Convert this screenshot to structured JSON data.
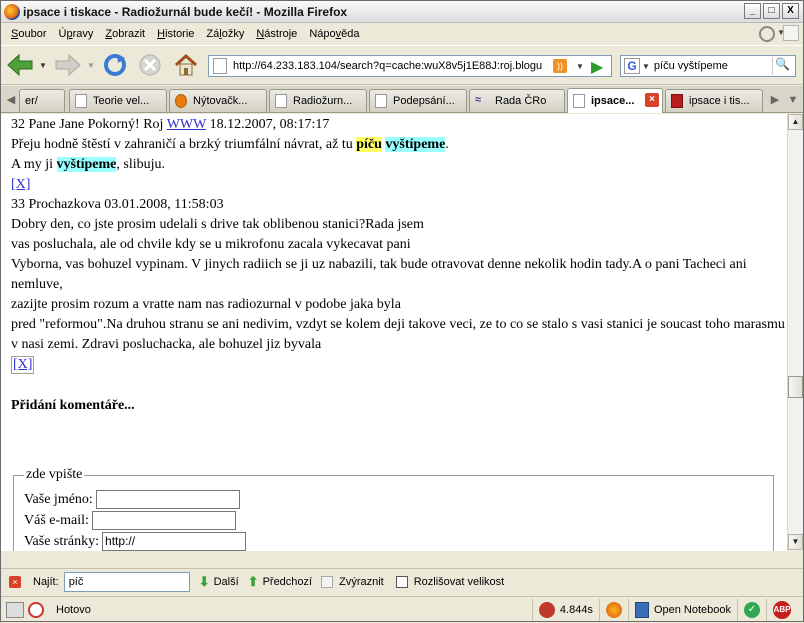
{
  "window": {
    "title": "ipsace i tiskace - Radiožurnál bude kečí! - Mozilla Firefox",
    "buttons": {
      "minimize": "_",
      "maximize": "□",
      "close": "X"
    }
  },
  "menu": [
    "Soubor",
    "Úpravy",
    "Zobrazit",
    "Historie",
    "Záložky",
    "Nástroje",
    "Nápověda"
  ],
  "menu_access_keys": [
    "S",
    "p",
    "Z",
    "H",
    "l",
    "N",
    "v"
  ],
  "navigation": {
    "url": "http://64.233.183.104/search?q=cache:wuX8v5j1E88J:roj.blogu",
    "search_engine": "G",
    "search_value": "píču vyštípeme"
  },
  "tabs": [
    {
      "label": "er/",
      "icon": "none"
    },
    {
      "label": "Teorie vel...",
      "icon": "page-icon"
    },
    {
      "label": "Nýtovačk...",
      "icon": "e-icon"
    },
    {
      "label": "Radiožurn...",
      "icon": "page-icon"
    },
    {
      "label": "Podepsání...",
      "icon": "page-icon"
    },
    {
      "label": "Rada ČRo",
      "icon": "cro-icon"
    },
    {
      "label": "ipsace...",
      "icon": "page-icon",
      "active": true
    },
    {
      "label": "ipsace i tis...",
      "icon": "red-icon"
    }
  ],
  "content": {
    "comment32": {
      "header_pre": "32 Pane Jane Pokorný! Roj",
      "header_link": "WWW",
      "header_post": "18.12.2007, 08:17:17",
      "line1_pre": "Přeju hodně štěstí v zahraničí a brzký triumfální návrat, až tu",
      "line1_hl1": "píču",
      "line1_hl2": "vyštípeme",
      "line1_post": ".",
      "line2_pre": "A my ji",
      "line2_hl": "vyštípeme",
      "line2_post": ", slibuju.",
      "delete": "[X]"
    },
    "comment33": {
      "header": "33 Prochazkova 03.01.2008, 11:58:03",
      "lines": [
        "Dobry den, co jste prosim udelali s drive tak oblibenou stanici?Rada jsem",
        "vas posluchala, ale od chvile kdy se u mikrofonu zacala vykecavat pani",
        "Vyborna, vas bohuzel vypinam. V jinych radiich se ji uz nabazili, tak bude otravovat denne nekolik hodin tady.A o pani Tacheci ani nemluve,",
        "zazijte prosim rozum a vratte nam nas radiozurnal v podobe jaka byla",
        "pred \"reformou\".Na druhou stranu se ani nedivim, vzdyt se kolem deji takove veci, ze to co se stalo s vasi stanici je soucast toho marasmu",
        "v nasi zemi. Zdravi posluchacka, ale bohuzel jiz byvala"
      ],
      "delete": "[X]"
    },
    "form": {
      "title": "Přidání komentáře...",
      "legend": "zde vpište",
      "name_label": "Vaše jméno:",
      "email_label": "Váš e-mail:",
      "web_label": "Vaše stránky:",
      "web_value": "http://"
    }
  },
  "findbar": {
    "label": "Najít:",
    "value": "píč",
    "next": "Další",
    "prev": "Předchozí",
    "highlight": "Zvýraznit",
    "match_case": "Rozlišovat velikost"
  },
  "statusbar": {
    "status": "Hotovo",
    "timer": "4.844s",
    "notebook": "Open Notebook",
    "abp": "ABP"
  },
  "colors": {
    "highlight_yellow": "#ffff66",
    "highlight_cyan": "#99ffff",
    "link": "#2d2dcc"
  }
}
